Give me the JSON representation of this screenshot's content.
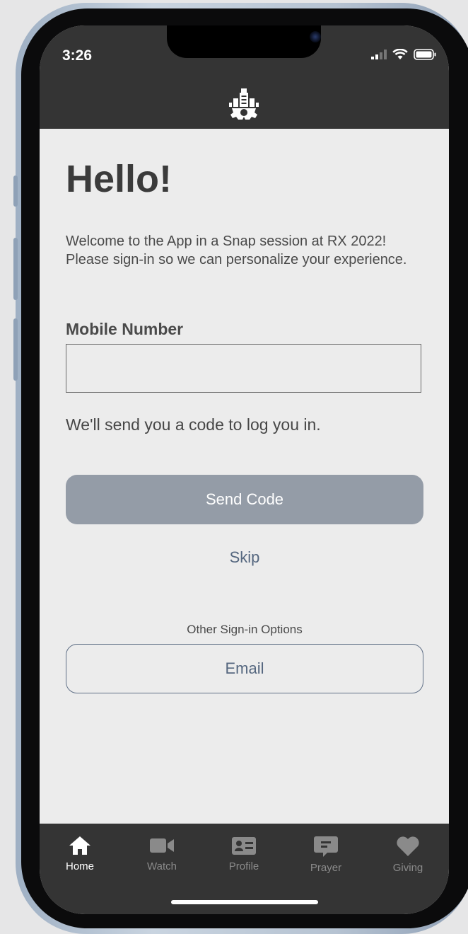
{
  "status_bar": {
    "time": "3:26"
  },
  "header": {
    "logo_icon": "church-gear-logo-icon"
  },
  "main": {
    "title": "Hello!",
    "welcome_text": "Welcome to the App in a Snap session at RX 2022! Please sign-in so we can personalize your experience.",
    "mobile_label": "Mobile Number",
    "mobile_value": "",
    "mobile_placeholder": "",
    "hint": "We'll send you a code to log you in.",
    "send_code_label": "Send Code",
    "skip_label": "Skip",
    "other_options_label": "Other Sign-in Options",
    "email_label": "Email"
  },
  "tabbar": {
    "items": [
      {
        "label": "Home",
        "icon": "home-icon",
        "active": true
      },
      {
        "label": "Watch",
        "icon": "video-camera-icon",
        "active": false
      },
      {
        "label": "Profile",
        "icon": "id-card-icon",
        "active": false
      },
      {
        "label": "Prayer",
        "icon": "chat-bubble-icon",
        "active": false
      },
      {
        "label": "Giving",
        "icon": "heart-icon",
        "active": false
      }
    ]
  },
  "colors": {
    "header_bg": "#343434",
    "screen_bg": "#ececec",
    "send_button_bg": "#949ca7",
    "link_color": "#55677f"
  }
}
